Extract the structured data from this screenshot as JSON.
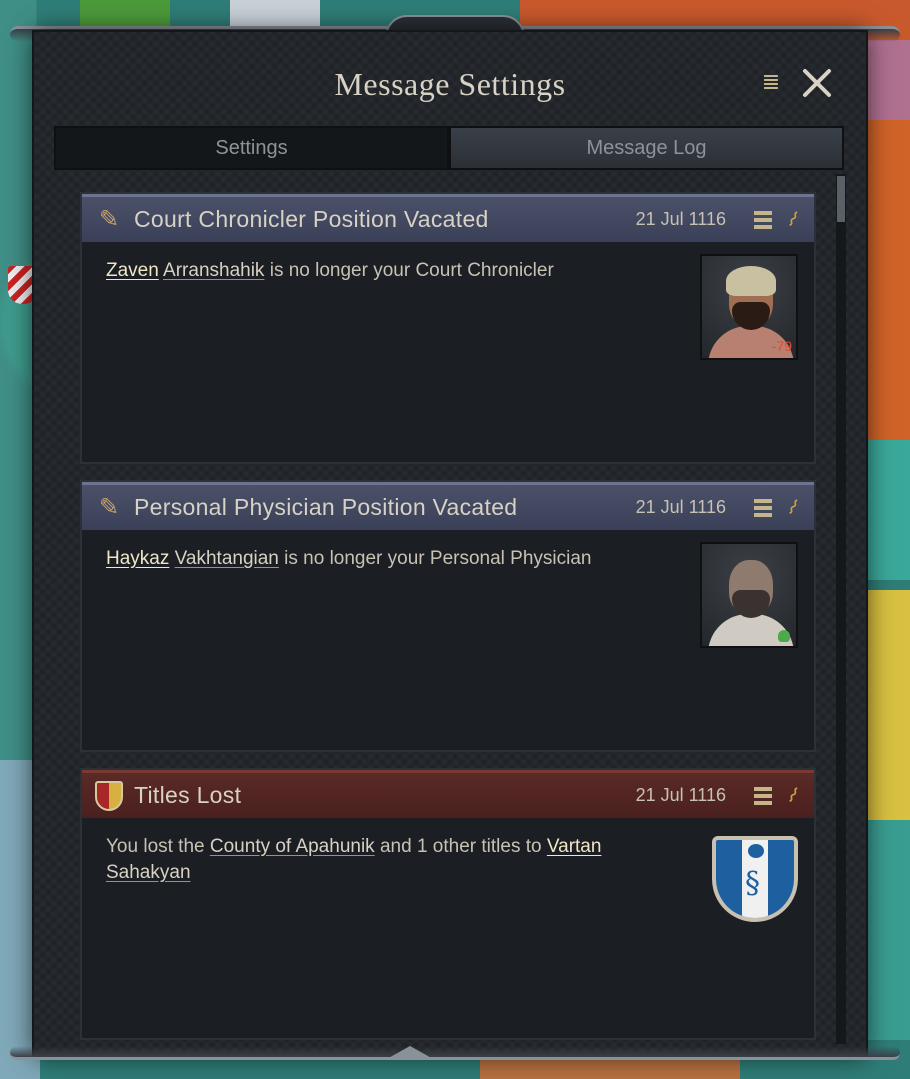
{
  "window": {
    "title": "Message Settings",
    "tabs": [
      {
        "label": "Settings",
        "active": false
      },
      {
        "label": "Message Log",
        "active": true
      }
    ]
  },
  "icons": {
    "scroll": "scroll-icon",
    "close": "close-icon",
    "list": "list-icon",
    "broom": "broom-icon",
    "quill": "quill-icon",
    "shield": "shield-icon"
  },
  "messages": [
    {
      "title": "Court Chronicler Position Vacated",
      "date": "21 Jul 1116",
      "text_parts": {
        "first_name": "Zaven",
        "last_name": "Arranshahik",
        "rest": " is no longer your Court Chronicler"
      },
      "portrait": {
        "opinion": "-79"
      }
    },
    {
      "title": "Personal Physician Position Vacated",
      "date": "21 Jul 1116",
      "text_parts": {
        "first_name": "Haykaz",
        "last_name": "Vakhtangian",
        "rest": " is no longer your Personal Physician"
      }
    },
    {
      "title": "Titles Lost",
      "date": "21 Jul 1116",
      "text_parts": {
        "prefix": "You lost the ",
        "county": "County of Apahunik",
        "middle": " and 1 other titles to ",
        "holder_first": "Vartan",
        "holder_last": "Sahakyan"
      }
    }
  ],
  "colors": {
    "header_blue": "#4a5168",
    "header_red": "#5a2a26",
    "opinion_negative": "#e04a3a"
  }
}
